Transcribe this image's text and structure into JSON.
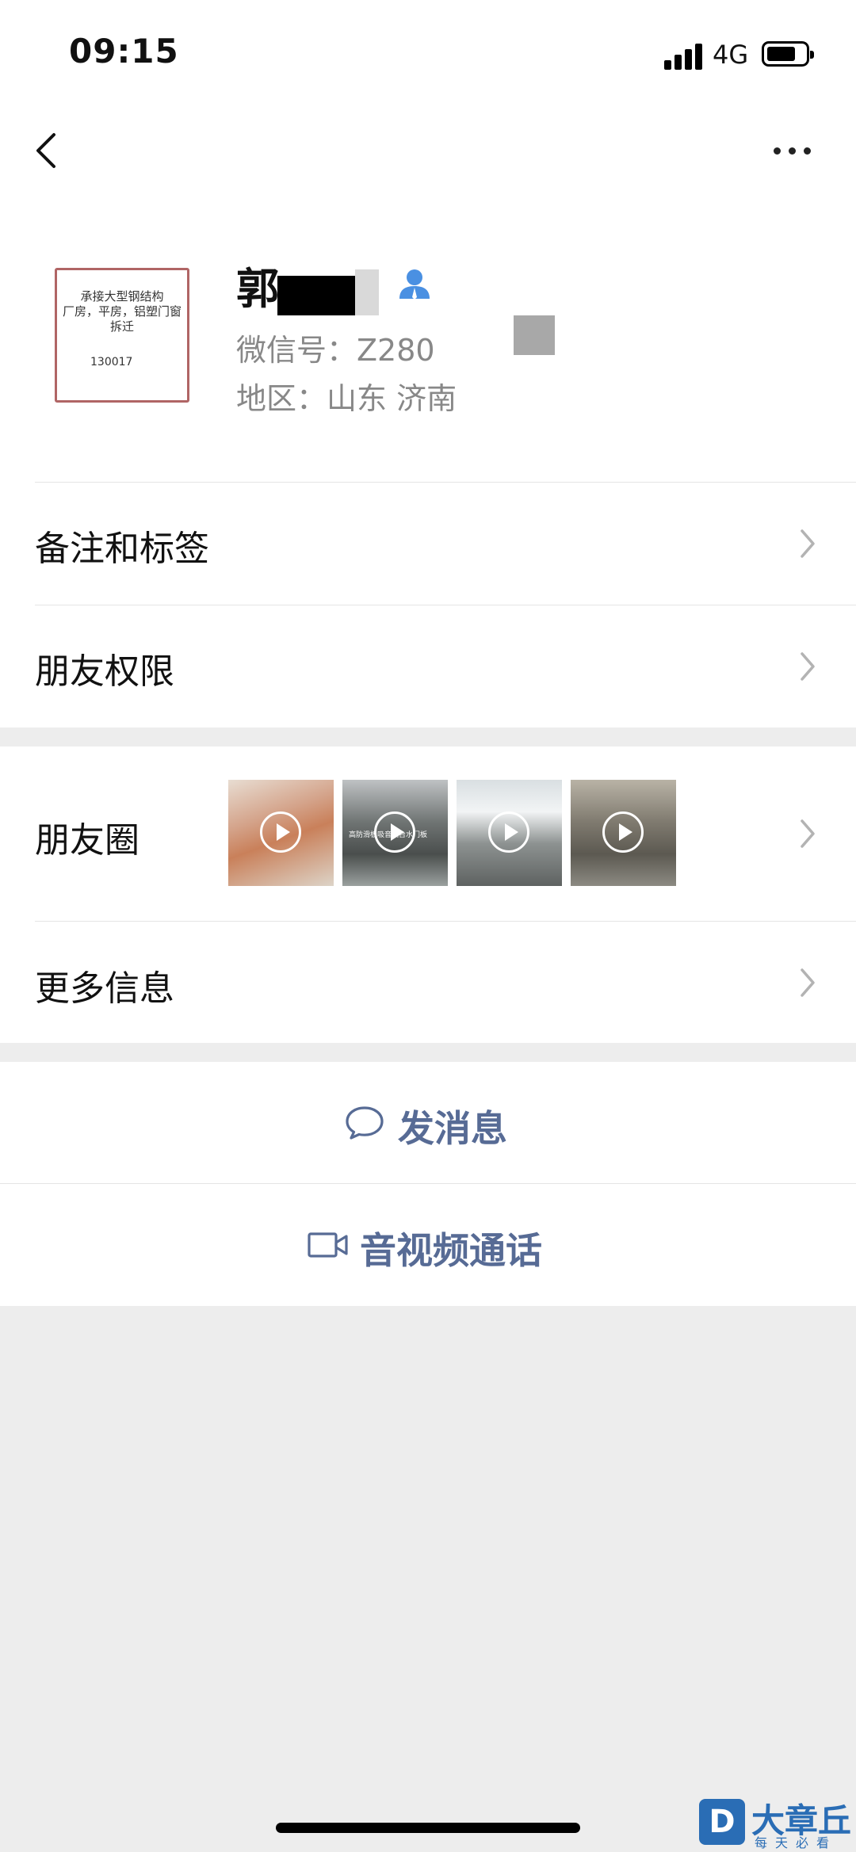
{
  "status_bar": {
    "time": "09:15",
    "network": "4G"
  },
  "profile": {
    "avatar_text": [
      "承接大型钢结构",
      "厂房，平房，铝塑门窗",
      "拆迁"
    ],
    "avatar_phone": "130017",
    "name": "郭",
    "wechat_id": "微信号：Z280",
    "region": "地区：山东 济南"
  },
  "menu": {
    "remark_tags": "备注和标签",
    "friend_permissions": "朋友权限",
    "moments": "朋友圈",
    "moments_thumb_caption": "高防滑板吸音隔台水门板",
    "more_info": "更多信息"
  },
  "actions": {
    "send_message": "发消息",
    "av_call": "音视频通话"
  },
  "watermark": {
    "badge": "D",
    "name": "大章丘",
    "slogan": "每天必看"
  },
  "colors": {
    "link": "#576b95",
    "contact_icon": "#4a90e2",
    "background": "#ededed"
  }
}
